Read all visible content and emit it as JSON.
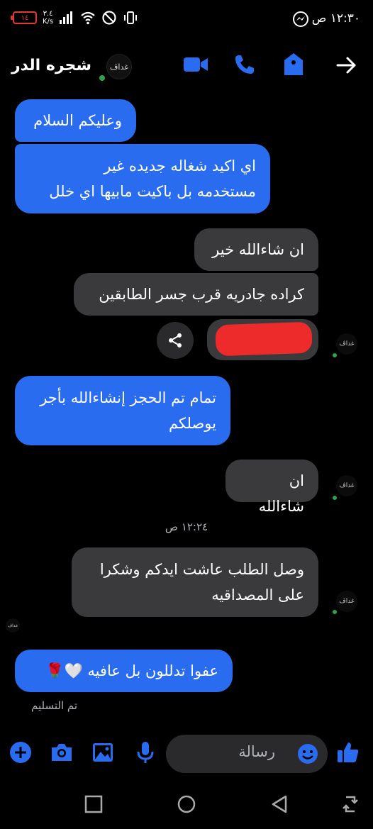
{
  "status_bar": {
    "time": "١٢:٣٠ ص",
    "battery": "١٤",
    "speed_value": "٣.٤",
    "speed_unit": "K/s"
  },
  "header": {
    "contact_name": "شجره الدر",
    "avatar_logo": "غداڤ"
  },
  "messages": [
    {
      "id": "m1",
      "direction": "outgoing",
      "text": "وعليكم السلام"
    },
    {
      "id": "m2",
      "direction": "outgoing",
      "lines": [
        "اي اكيد شغاله جديده غير",
        "مستخدمه بل باكيت مابيها اي خلل"
      ]
    },
    {
      "id": "m3",
      "direction": "incoming",
      "text": "ان شاءالله خير"
    },
    {
      "id": "m4",
      "direction": "incoming",
      "text": "كراده جادريه قرب جسر الطابقين"
    },
    {
      "id": "m5",
      "direction": "incoming",
      "text": "",
      "note": "redacted attachment"
    },
    {
      "id": "m6",
      "direction": "outgoing",
      "lines": [
        "تمام تم الحجز إنشاءالله بأجر",
        "يوصلكم"
      ]
    },
    {
      "id": "m7",
      "direction": "incoming",
      "text": "ان شاءالله"
    },
    {
      "id": "m8",
      "direction": "incoming",
      "lines": [
        "وصل الطلب عاشت ايدكم  وشكرا",
        "على المصداقيه"
      ]
    },
    {
      "id": "m9",
      "direction": "outgoing",
      "text": "عفوا تدللون بل عافيه 🤍🌹"
    }
  ],
  "timestamp": "١٢:٢٤ ص",
  "delivery_status": "تم التسليم",
  "composer": {
    "placeholder": "رسالة"
  },
  "colors": {
    "accent": "#2a6cf0",
    "outgoing_bubble": "#2a6cf0",
    "incoming_bubble": "#3a3a3c",
    "online": "#31a24c",
    "battery_low": "#e53935",
    "redaction": "#ee2b2b"
  }
}
